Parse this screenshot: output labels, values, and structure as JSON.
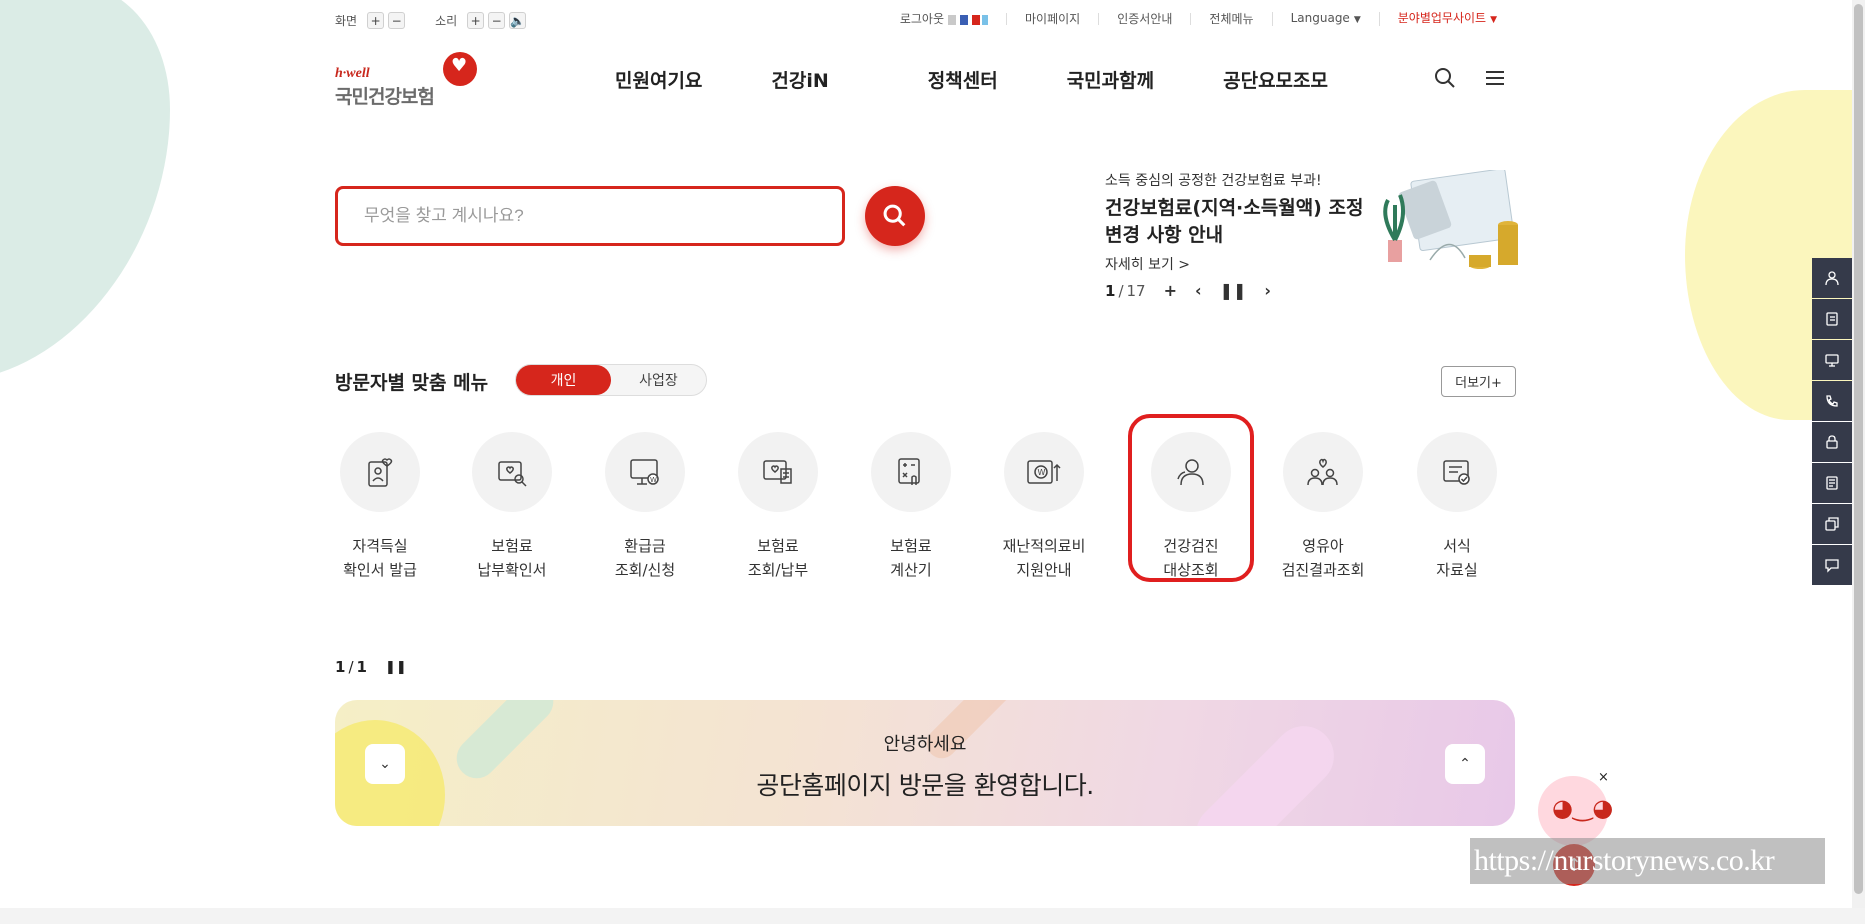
{
  "util": {
    "screen_label": "화면",
    "sound_label": "소리",
    "plus": "+",
    "minus": "−",
    "speaker": "🔈",
    "links": [
      "로그아웃",
      "마이페이지",
      "인증서안내",
      "전체메뉴"
    ],
    "language": "Language",
    "sites": "분야별업무사이트"
  },
  "logo": {
    "small": "h·well",
    "big": "국민건강보험"
  },
  "nav": [
    "민원여기요",
    "건강iN",
    "정책센터",
    "국민과함께",
    "공단요모조모"
  ],
  "search": {
    "placeholder": "무엇을 찾고 계시나요?"
  },
  "notice": {
    "sub": "소득 중심의 공정한 건강보험료 부과!",
    "title": "건강보험료(지역·소득월액) 조정 변경 사항 안내",
    "more": "자세히 보기 >",
    "current": "1",
    "separator": "/",
    "total": "17"
  },
  "visitor": {
    "title": "방문자별 맞춤 메뉴",
    "tab_personal": "개인",
    "tab_business": "사업장",
    "more": "더보기+"
  },
  "quick_menu": [
    {
      "label": "자격득실\n확인서 발급",
      "icon": "person-card-icon"
    },
    {
      "label": "보험료\n납부확인서",
      "icon": "heart-search-icon"
    },
    {
      "label": "환급금\n조회/신청",
      "icon": "monitor-won-icon"
    },
    {
      "label": "보험료\n조회/납부",
      "icon": "heart-document-icon"
    },
    {
      "label": "보험료\n계산기",
      "icon": "calculator-hand-icon"
    },
    {
      "label": "재난적의료비\n지원안내",
      "icon": "won-support-icon"
    },
    {
      "label": "건강검진\n대상조회",
      "icon": "persons-icon"
    },
    {
      "label": "영유아\n검진결과조회",
      "icon": "family-heart-icon"
    },
    {
      "label": "서식\n자료실",
      "icon": "form-check-icon"
    }
  ],
  "pager2": {
    "current": "1",
    "separator": "/",
    "total": "1"
  },
  "welcome": {
    "hi": "안녕하세요",
    "message": "공단홈페이지 방문을 환영합니다."
  },
  "sidebar_icons": [
    "user-icon",
    "document-icon",
    "monitor-icon",
    "phone-icon",
    "lock-icon",
    "list-icon",
    "copy-icon",
    "chat-icon"
  ],
  "watermark": "https://nurstorynews.co.kr",
  "colors": {
    "brand_red": "#d6261c",
    "sidebar": "#353a4a",
    "highlight": "#e01f1f"
  }
}
